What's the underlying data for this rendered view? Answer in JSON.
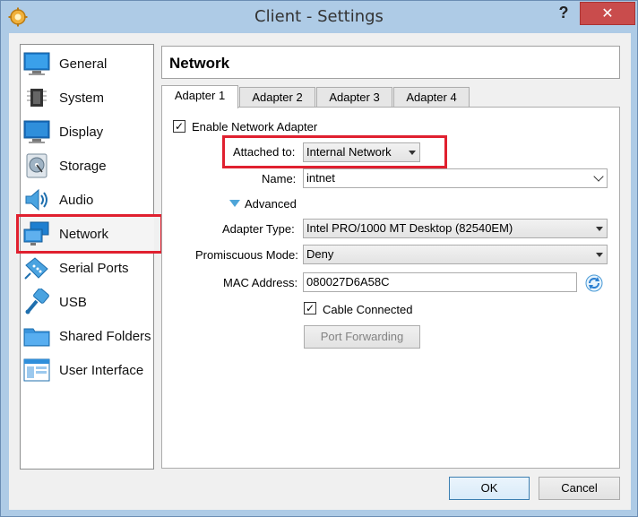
{
  "window": {
    "title": "Client - Settings",
    "help": "?",
    "close": "✕"
  },
  "sidebar": {
    "items": [
      {
        "label": "General",
        "icon": "general-icon"
      },
      {
        "label": "System",
        "icon": "system-icon"
      },
      {
        "label": "Display",
        "icon": "display-icon"
      },
      {
        "label": "Storage",
        "icon": "storage-icon"
      },
      {
        "label": "Audio",
        "icon": "audio-icon"
      },
      {
        "label": "Network",
        "icon": "network-icon",
        "selected": true
      },
      {
        "label": "Serial Ports",
        "icon": "serial-ports-icon"
      },
      {
        "label": "USB",
        "icon": "usb-icon"
      },
      {
        "label": "Shared Folders",
        "icon": "shared-folders-icon"
      },
      {
        "label": "User Interface",
        "icon": "user-interface-icon"
      }
    ]
  },
  "header": {
    "title": "Network"
  },
  "tabs": [
    {
      "label": "Adapter 1",
      "active": true
    },
    {
      "label": "Adapter 2"
    },
    {
      "label": "Adapter 3"
    },
    {
      "label": "Adapter 4"
    }
  ],
  "adapter": {
    "enable_label": "Enable Network Adapter",
    "enabled": true,
    "attached_label": "Attached to:",
    "attached_value": "Internal Network",
    "name_label": "Name:",
    "name_value": "intnet",
    "advanced_label": "Advanced",
    "adapter_type_label": "Adapter Type:",
    "adapter_type_value": "Intel PRO/1000 MT Desktop (82540EM)",
    "promiscuous_label": "Promiscuous Mode:",
    "promiscuous_value": "Deny",
    "mac_label": "MAC Address:",
    "mac_value": "080027D6A58C",
    "cable_label": "Cable Connected",
    "cable_connected": true,
    "port_forwarding_label": "Port Forwarding"
  },
  "footer": {
    "ok_label": "OK",
    "cancel_label": "Cancel"
  },
  "colors": {
    "highlight": "#e0202f",
    "accent": "#2b7fd1",
    "close": "#c94c4c"
  }
}
